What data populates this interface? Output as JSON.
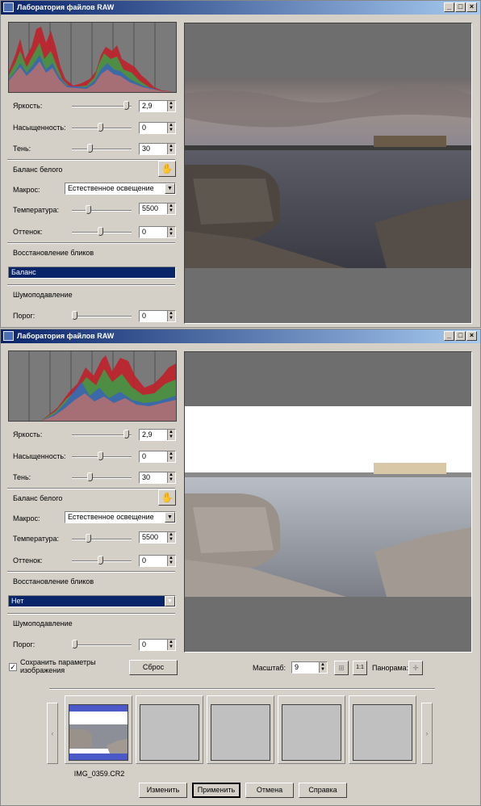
{
  "title": "Лаборатория файлов RAW",
  "window_buttons": {
    "minimize": "_",
    "maximize": "□",
    "close": "×"
  },
  "labels": {
    "brightness": "Яркость:",
    "saturation": "Насыщенность:",
    "shadow": "Тень:",
    "white_balance": "Баланс белого",
    "macro": "Макрос:",
    "temperature": "Температура:",
    "tint": "Оттенок:",
    "highlight_recovery": "Восстановление бликов",
    "noise_reduction": "Шумоподавление",
    "threshold": "Порог:"
  },
  "top": {
    "brightness": "2,9",
    "saturation": "0",
    "shadow": "30",
    "macro": "Естественное освещение",
    "temperature": "5500",
    "tint": "0",
    "highlight": "Баланс",
    "threshold": "0"
  },
  "bottom": {
    "brightness": "2,9",
    "saturation": "0",
    "shadow": "30",
    "macro": "Естественное освещение",
    "temperature": "5500",
    "tint": "0",
    "highlight": "Нет",
    "threshold": "0"
  },
  "save_params_label": "Сохранить параметры изображения",
  "save_params_checked": true,
  "reset_label": "Сброс",
  "zoom_label": "Масштаб:",
  "zoom_value": "9",
  "panorama_label": "Панорама:",
  "thumbnail_filename": "IMG_0359.CR2",
  "buttons": {
    "change": "Изменить",
    "apply": "Применить",
    "cancel": "Отмена",
    "help": "Справка"
  },
  "icons": {
    "hand": "hand-icon",
    "fit": "fit-icon",
    "one_to_one": "1:1",
    "pan": "pan-icon"
  },
  "colors": {
    "titlebar": "#0a246a",
    "selection": "#0a246a",
    "preview_bg": "#6e6e6e"
  }
}
